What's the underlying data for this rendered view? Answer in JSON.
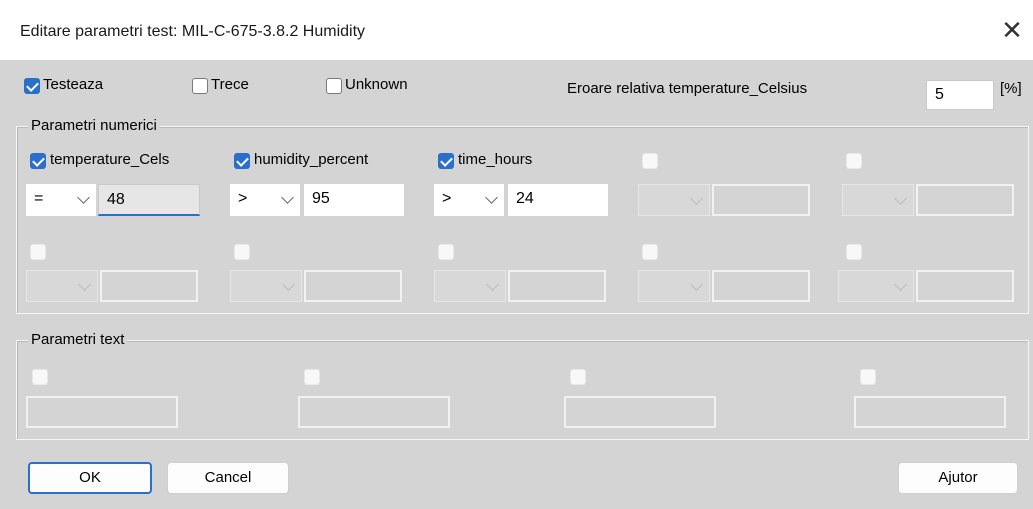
{
  "window": {
    "title": "Editare parametri test:  MIL-C-675-3.8.2 Humidity"
  },
  "top_checks": [
    {
      "label": "Testeaza",
      "checked": true
    },
    {
      "label": "Trece",
      "checked": false
    },
    {
      "label": "Unknown",
      "checked": false
    }
  ],
  "relative_error": {
    "label": "Eroare relativa temperature_Celsius",
    "value": "5",
    "unit": "[%]"
  },
  "numeric_group": {
    "label": "Parametri numerici",
    "params": [
      {
        "label": "temperature_Cels",
        "checked": true,
        "operator": "=",
        "value": "48"
      },
      {
        "label": "humidity_percent",
        "checked": true,
        "operator": ">",
        "value": "95"
      },
      {
        "label": "time_hours",
        "checked": true,
        "operator": ">",
        "value": "24"
      }
    ]
  },
  "text_group": {
    "label": "Parametri text"
  },
  "buttons": {
    "ok": "OK",
    "cancel": "Cancel",
    "help": "Ajutor"
  }
}
